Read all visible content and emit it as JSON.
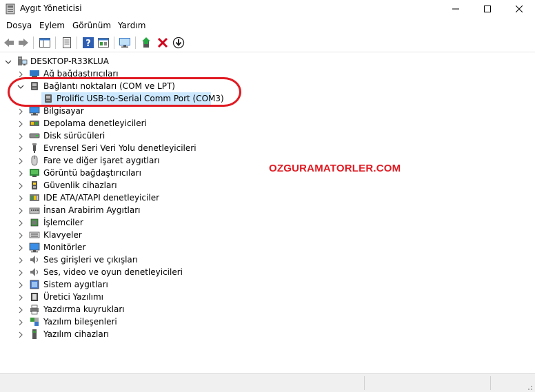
{
  "window": {
    "title": "Aygıt Yöneticisi"
  },
  "menu": [
    "Dosya",
    "Eylem",
    "Görünüm",
    "Yardım"
  ],
  "tree": {
    "root": "DESKTOP-R33KLUA",
    "nodes": [
      {
        "label": "Ağ bağdaştırıcıları",
        "icon": "network-adapter-icon",
        "expanded": false
      },
      {
        "label": "Bağlantı noktaları (COM ve LPT)",
        "icon": "port-icon",
        "expanded": true,
        "children": [
          {
            "label": "Prolific USB-to-Serial Comm Port (COM3)",
            "icon": "port-icon",
            "selected": true
          }
        ]
      },
      {
        "label": "Bilgisayar",
        "icon": "computer-icon",
        "expanded": false
      },
      {
        "label": "Depolama denetleyicileri",
        "icon": "storage-controller-icon",
        "expanded": false
      },
      {
        "label": "Disk sürücüleri",
        "icon": "disk-drive-icon",
        "expanded": false
      },
      {
        "label": "Evrensel Seri Veri Yolu denetleyicileri",
        "icon": "usb-icon",
        "expanded": false
      },
      {
        "label": "Fare ve diğer işaret aygıtları",
        "icon": "mouse-icon",
        "expanded": false
      },
      {
        "label": "Görüntü bağdaştırıcıları",
        "icon": "display-adapter-icon",
        "expanded": false
      },
      {
        "label": "Güvenlik cihazları",
        "icon": "security-device-icon",
        "expanded": false
      },
      {
        "label": "IDE ATA/ATAPI denetleyiciler",
        "icon": "ide-controller-icon",
        "expanded": false
      },
      {
        "label": "İnsan Arabirim Aygıtları",
        "icon": "hid-icon",
        "expanded": false
      },
      {
        "label": "İşlemciler",
        "icon": "processor-icon",
        "expanded": false
      },
      {
        "label": "Klavyeler",
        "icon": "keyboard-icon",
        "expanded": false
      },
      {
        "label": "Monitörler",
        "icon": "monitor-icon",
        "expanded": false
      },
      {
        "label": "Ses girişleri ve çıkışları",
        "icon": "speaker-icon",
        "expanded": false
      },
      {
        "label": "Ses, video ve oyun denetleyicileri",
        "icon": "speaker-icon",
        "expanded": false
      },
      {
        "label": "Sistem aygıtları",
        "icon": "system-device-icon",
        "expanded": false
      },
      {
        "label": "Üretici Yazılımı",
        "icon": "firmware-icon",
        "expanded": false
      },
      {
        "label": "Yazdırma kuyrukları",
        "icon": "print-queue-icon",
        "expanded": false
      },
      {
        "label": "Yazılım bileşenleri",
        "icon": "software-component-icon",
        "expanded": false
      },
      {
        "label": "Yazılım cihazları",
        "icon": "software-device-icon",
        "expanded": false
      }
    ]
  },
  "watermark": "OZGURAMATORLER.COM",
  "colors": {
    "annotation": "#e01a22",
    "selection": "#cce8ff"
  }
}
